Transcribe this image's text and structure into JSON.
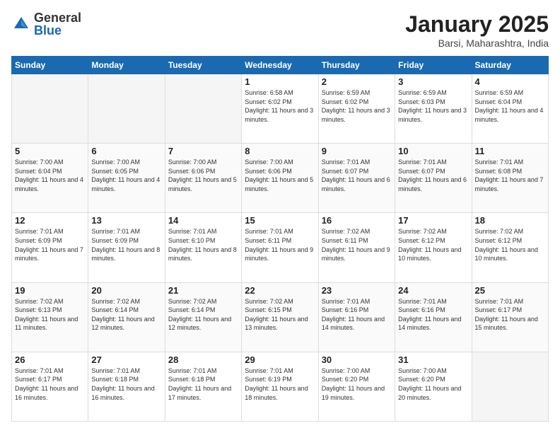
{
  "logo": {
    "general": "General",
    "blue": "Blue"
  },
  "header": {
    "title": "January 2025",
    "location": "Barsi, Maharashtra, India"
  },
  "weekdays": [
    "Sunday",
    "Monday",
    "Tuesday",
    "Wednesday",
    "Thursday",
    "Friday",
    "Saturday"
  ],
  "weeks": [
    [
      {
        "day": "",
        "info": ""
      },
      {
        "day": "",
        "info": ""
      },
      {
        "day": "",
        "info": ""
      },
      {
        "day": "1",
        "info": "Sunrise: 6:58 AM\nSunset: 6:02 PM\nDaylight: 11 hours and 3 minutes."
      },
      {
        "day": "2",
        "info": "Sunrise: 6:59 AM\nSunset: 6:02 PM\nDaylight: 11 hours and 3 minutes."
      },
      {
        "day": "3",
        "info": "Sunrise: 6:59 AM\nSunset: 6:03 PM\nDaylight: 11 hours and 3 minutes."
      },
      {
        "day": "4",
        "info": "Sunrise: 6:59 AM\nSunset: 6:04 PM\nDaylight: 11 hours and 4 minutes."
      }
    ],
    [
      {
        "day": "5",
        "info": "Sunrise: 7:00 AM\nSunset: 6:04 PM\nDaylight: 11 hours and 4 minutes."
      },
      {
        "day": "6",
        "info": "Sunrise: 7:00 AM\nSunset: 6:05 PM\nDaylight: 11 hours and 4 minutes."
      },
      {
        "day": "7",
        "info": "Sunrise: 7:00 AM\nSunset: 6:06 PM\nDaylight: 11 hours and 5 minutes."
      },
      {
        "day": "8",
        "info": "Sunrise: 7:00 AM\nSunset: 6:06 PM\nDaylight: 11 hours and 5 minutes."
      },
      {
        "day": "9",
        "info": "Sunrise: 7:01 AM\nSunset: 6:07 PM\nDaylight: 11 hours and 6 minutes."
      },
      {
        "day": "10",
        "info": "Sunrise: 7:01 AM\nSunset: 6:07 PM\nDaylight: 11 hours and 6 minutes."
      },
      {
        "day": "11",
        "info": "Sunrise: 7:01 AM\nSunset: 6:08 PM\nDaylight: 11 hours and 7 minutes."
      }
    ],
    [
      {
        "day": "12",
        "info": "Sunrise: 7:01 AM\nSunset: 6:09 PM\nDaylight: 11 hours and 7 minutes."
      },
      {
        "day": "13",
        "info": "Sunrise: 7:01 AM\nSunset: 6:09 PM\nDaylight: 11 hours and 8 minutes."
      },
      {
        "day": "14",
        "info": "Sunrise: 7:01 AM\nSunset: 6:10 PM\nDaylight: 11 hours and 8 minutes."
      },
      {
        "day": "15",
        "info": "Sunrise: 7:01 AM\nSunset: 6:11 PM\nDaylight: 11 hours and 9 minutes."
      },
      {
        "day": "16",
        "info": "Sunrise: 7:02 AM\nSunset: 6:11 PM\nDaylight: 11 hours and 9 minutes."
      },
      {
        "day": "17",
        "info": "Sunrise: 7:02 AM\nSunset: 6:12 PM\nDaylight: 11 hours and 10 minutes."
      },
      {
        "day": "18",
        "info": "Sunrise: 7:02 AM\nSunset: 6:12 PM\nDaylight: 11 hours and 10 minutes."
      }
    ],
    [
      {
        "day": "19",
        "info": "Sunrise: 7:02 AM\nSunset: 6:13 PM\nDaylight: 11 hours and 11 minutes."
      },
      {
        "day": "20",
        "info": "Sunrise: 7:02 AM\nSunset: 6:14 PM\nDaylight: 11 hours and 12 minutes."
      },
      {
        "day": "21",
        "info": "Sunrise: 7:02 AM\nSunset: 6:14 PM\nDaylight: 11 hours and 12 minutes."
      },
      {
        "day": "22",
        "info": "Sunrise: 7:02 AM\nSunset: 6:15 PM\nDaylight: 11 hours and 13 minutes."
      },
      {
        "day": "23",
        "info": "Sunrise: 7:01 AM\nSunset: 6:16 PM\nDaylight: 11 hours and 14 minutes."
      },
      {
        "day": "24",
        "info": "Sunrise: 7:01 AM\nSunset: 6:16 PM\nDaylight: 11 hours and 14 minutes."
      },
      {
        "day": "25",
        "info": "Sunrise: 7:01 AM\nSunset: 6:17 PM\nDaylight: 11 hours and 15 minutes."
      }
    ],
    [
      {
        "day": "26",
        "info": "Sunrise: 7:01 AM\nSunset: 6:17 PM\nDaylight: 11 hours and 16 minutes."
      },
      {
        "day": "27",
        "info": "Sunrise: 7:01 AM\nSunset: 6:18 PM\nDaylight: 11 hours and 16 minutes."
      },
      {
        "day": "28",
        "info": "Sunrise: 7:01 AM\nSunset: 6:18 PM\nDaylight: 11 hours and 17 minutes."
      },
      {
        "day": "29",
        "info": "Sunrise: 7:01 AM\nSunset: 6:19 PM\nDaylight: 11 hours and 18 minutes."
      },
      {
        "day": "30",
        "info": "Sunrise: 7:00 AM\nSunset: 6:20 PM\nDaylight: 11 hours and 19 minutes."
      },
      {
        "day": "31",
        "info": "Sunrise: 7:00 AM\nSunset: 6:20 PM\nDaylight: 11 hours and 20 minutes."
      },
      {
        "day": "",
        "info": ""
      }
    ]
  ]
}
